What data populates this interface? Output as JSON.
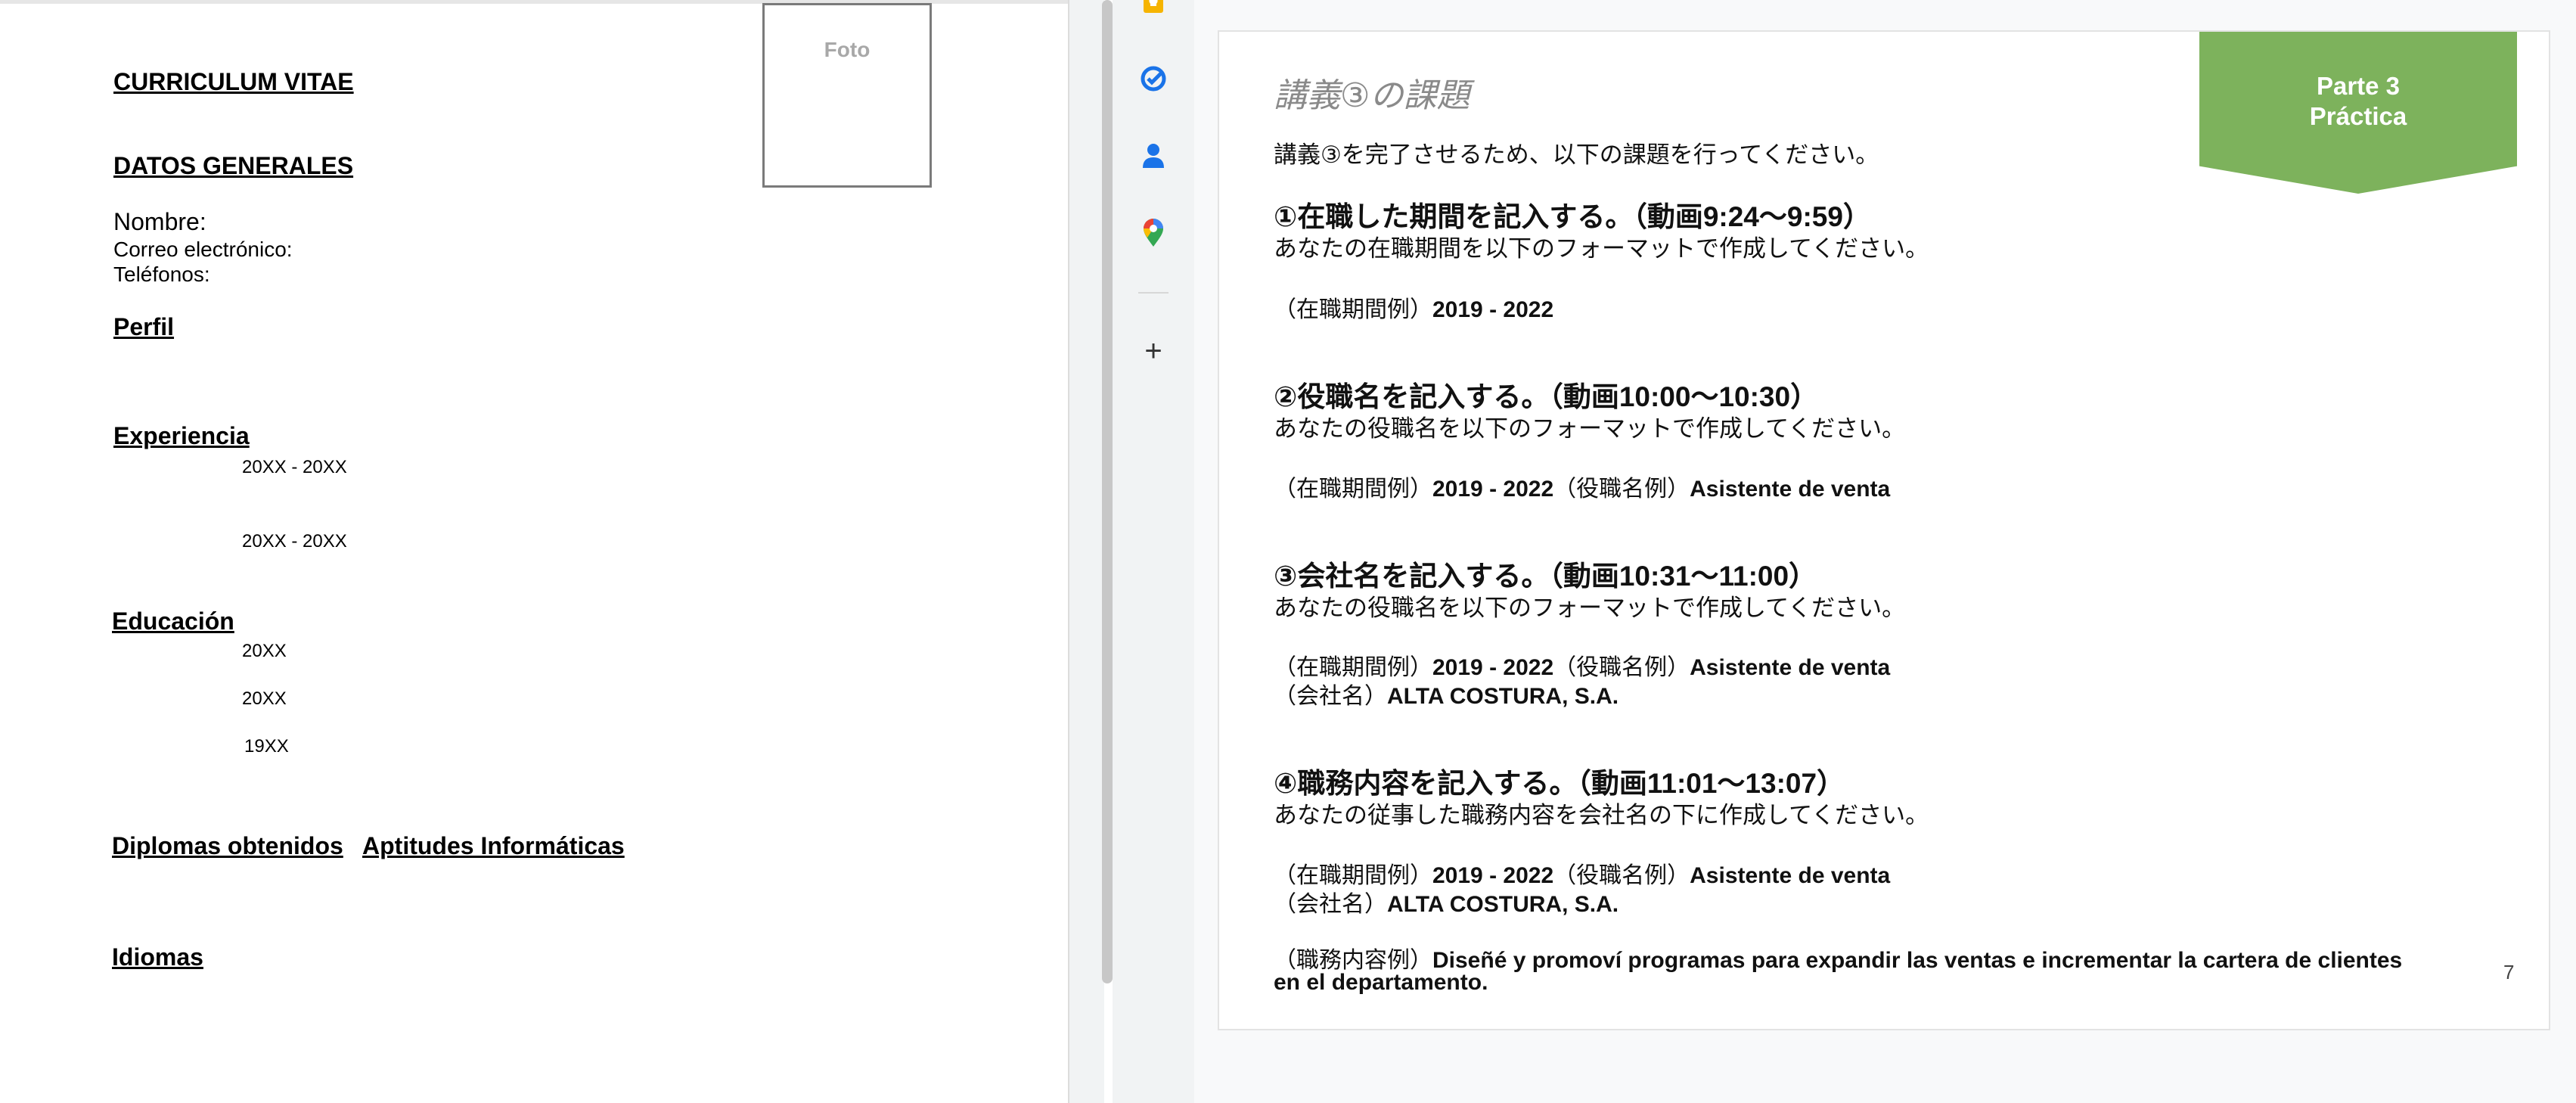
{
  "cv": {
    "title": "CURRICULUM VITAE",
    "photo_label": "Foto",
    "general_heading": "DATOS GENERALES",
    "name_label": "Nombre:",
    "email_label": "Correo electrónico:",
    "phone_label": "Teléfonos:",
    "profile_heading": "Perfil",
    "experience_heading": "Experiencia",
    "experience_dates": [
      "20XX - 20XX",
      "20XX - 20XX"
    ],
    "education_heading": "Educación",
    "education_dates": [
      "20XX",
      "20XX",
      "19XX"
    ],
    "diplomas_heading": "Diplomas obtenidos",
    "skills_heading": "Aptitudes Informáticas",
    "languages_heading": "Idiomas"
  },
  "side_panel": {
    "icons": [
      "keep-icon",
      "tasks-icon",
      "contacts-icon",
      "maps-icon",
      "add-icon"
    ],
    "add_label": "+"
  },
  "slide": {
    "title": "講義③の課題",
    "banner_line1": "Parte 3",
    "banner_line2": "Práctica",
    "intro": "講義③を完了させるため、以下の課題を行ってください。",
    "task1_heading": "①在職した期間を記入する。（動画9:24〜9:59）",
    "task1_desc": "あなたの在職期間を以下のフォーマットで作成してください。",
    "task2_heading": "②役職名を記入する。（動画10:00〜10:30）",
    "task2_desc": "あなたの役職名を以下のフォーマットで作成してください。",
    "task3_heading": "③会社名を記入する。（動画10:31〜11:00）",
    "task3_desc": "あなたの役職名を以下のフォーマットで作成してください。",
    "task4_heading": "④職務内容を記入する。（動画11:01〜13:07）",
    "task4_desc": "あなたの従事した職務内容を会社名の下に作成してください。",
    "period_label": "（在職期間例）",
    "period_value": "2019 - 2022",
    "role_label": "（役職名例）",
    "role_value": "Asistente de venta",
    "company_label": "（会社名）",
    "company_value": "ALTA COSTURA, S.A.",
    "duties_label": "（職務内容例）",
    "duties_line1": "Diseñé y promoví programas para expandir las ventas e incrementar la cartera de clientes",
    "duties_line2": "en el departamento.",
    "page_number": "7"
  },
  "colors": {
    "banner_green": "#7db25c",
    "keep_yellow": "#f6b400",
    "tasks_blue": "#1a73e8",
    "contacts_blue": "#1a73e8"
  }
}
